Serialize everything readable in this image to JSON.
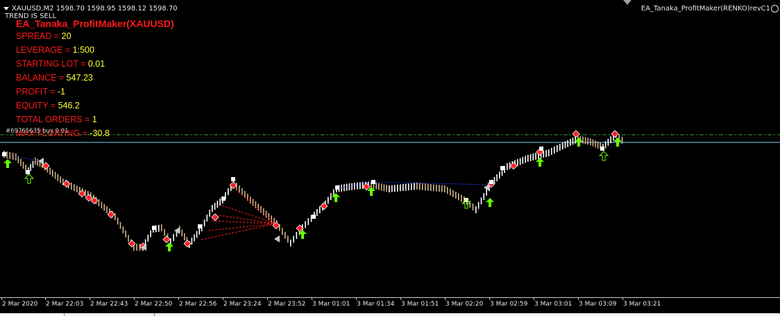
{
  "header": {
    "symbol_line": "XAUUSD,M2  1598.70 1598.95 1598.12 1598.70",
    "trend": "TREND IS SELL",
    "ea_name": "EA_Tanaka_ProfitMaker(RENKO)revC1"
  },
  "panel": {
    "title": "EA_Tanaka_ProfitMaker(XAUUSD)",
    "rows": [
      {
        "label": "SPREAD = ",
        "value": "20"
      },
      {
        "label": "LEVERAGE = ",
        "value": "1:500"
      },
      {
        "label": "STARTING LOT = ",
        "value": "0.01"
      },
      {
        "label": "BALANCE = ",
        "value": "547.23"
      },
      {
        "label": "PROFIT = ",
        "value": "-1"
      },
      {
        "label": "EQUITY = ",
        "value": "546.2"
      },
      {
        "label": "TOTAL ORDERS = ",
        "value": "1"
      },
      {
        "label": "MAX FLOATING = ",
        "value": "-30.8"
      }
    ]
  },
  "order": {
    "label": "#69765635 buy 0.01"
  },
  "xaxis": {
    "labels": [
      "2 Mar 2020",
      "2 Mar 22:03",
      "2 Mar 22:43",
      "2 Mar 22:50",
      "2 Mar 22:56",
      "2 Mar 23:24",
      "2 Mar 23:52",
      "3 Mar 01:01",
      "3 Mar 01:34",
      "3 Mar 01:51",
      "3 Mar 02:20",
      "3 Mar 02:59",
      "3 Mar 03:01",
      "3 Mar 03:09",
      "3 Mar 03:21"
    ]
  },
  "colors": {
    "background": "#000000",
    "label_red": "#ff1a1a",
    "value_yellow": "#ffff33",
    "buy_arrow": "#66ff00",
    "sell_marker": "#ff2020",
    "order_line": "#7fd7ff",
    "level_line": "#33aa33",
    "link_line": "#2040ff",
    "fan_line": "#ff2020"
  }
}
